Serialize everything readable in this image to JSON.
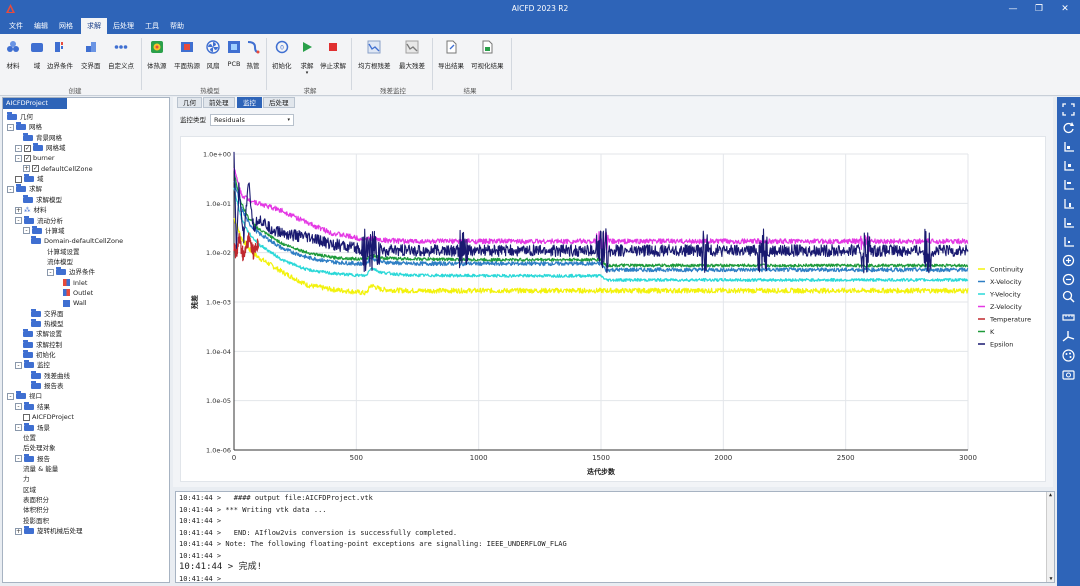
{
  "window": {
    "title": "AICFD 2023 R2"
  },
  "menu": [
    "文件",
    "编辑",
    "网格",
    "求解",
    "后处理",
    "工具",
    "帮助"
  ],
  "menu_active": "求解",
  "ribbon": {
    "groups": [
      {
        "label": "创建",
        "buttons": [
          "材料",
          "域",
          "边界条件",
          "交界面",
          "自定义点"
        ]
      },
      {
        "label": "热模型",
        "buttons": [
          "体热源",
          "平面热源",
          "风扇",
          "PCB",
          "热管"
        ]
      },
      {
        "label": "求解",
        "buttons": [
          "初始化",
          "求解",
          "停止求解"
        ]
      },
      {
        "label": "残差监控",
        "buttons": [
          "均方根残差",
          "最大残差"
        ]
      },
      {
        "label": "结果",
        "buttons": [
          "导出结果",
          "可视化结果"
        ]
      }
    ]
  },
  "tree": {
    "header": "AICFDProject",
    "nodes": [
      "几何",
      "网格",
      "背景网格",
      "网格域",
      "burner",
      "defaultCellZone",
      "域",
      "求解",
      "求解模型",
      "材料",
      "流动分析",
      "计算域",
      "Domain-defaultCellZone",
      "计算域设置",
      "流体模型",
      "边界条件",
      "Inlet",
      "Outlet",
      "Wall",
      "交界面",
      "热模型",
      "求解设置",
      "求解控制",
      "初始化",
      "监控",
      "残差曲线",
      "报告表",
      "视口",
      "结果",
      "AICFDProject",
      "场景",
      "位置",
      "后处理对象",
      "报告",
      "流量 & 能量",
      "力",
      "区域",
      "表面积分",
      "体积积分",
      "投影面积",
      "旋转机械后处理"
    ]
  },
  "tabs": [
    "几何",
    "前处理",
    "监控",
    "后处理"
  ],
  "tab_active": "监控",
  "monitor": {
    "type_label": "监控类型",
    "type_value": "Residuals"
  },
  "chart_data": {
    "type": "line",
    "xlabel": "迭代步数",
    "ylabel": "残差",
    "xlim": [
      0,
      3000
    ],
    "ylim": [
      1e-06,
      1
    ],
    "yscale": "log",
    "xticks": [
      "0",
      "500",
      "1000",
      "1500",
      "2000",
      "2500",
      "3000"
    ],
    "yticks": [
      "1.0e+00",
      "1.0e-01",
      "1.0e-02",
      "1.0e-03",
      "1.0e-04",
      "1.0e-05",
      "1.0e-06"
    ],
    "legend_position": "right",
    "series": [
      {
        "name": "Continuity",
        "color": "#f2f20c",
        "x": [
          0,
          30,
          60,
          100,
          200,
          300,
          400,
          500,
          540,
          560,
          600,
          700,
          1000,
          1500,
          2000,
          2500,
          3000
        ],
        "y": [
          0.05,
          0.02,
          0.012,
          0.008,
          0.004,
          0.0022,
          0.0018,
          0.0016,
          0.0015,
          0.0022,
          0.0018,
          0.0017,
          0.0017,
          0.0017,
          0.0017,
          0.0017,
          0.0017
        ]
      },
      {
        "name": "X-Velocity",
        "color": "#2e7ec4",
        "x": [
          0,
          30,
          60,
          100,
          200,
          300,
          400,
          500,
          540,
          560,
          600,
          700,
          1000,
          1500,
          1520,
          1600,
          2000,
          2500,
          3000
        ],
        "y": [
          0.3,
          0.08,
          0.04,
          0.025,
          0.012,
          0.008,
          0.0065,
          0.006,
          0.006,
          0.008,
          0.0065,
          0.006,
          0.006,
          0.006,
          0.0045,
          0.0045,
          0.0045,
          0.0045,
          0.0045
        ]
      },
      {
        "name": "Y-Velocity",
        "color": "#2ad8d8",
        "x": [
          0,
          30,
          60,
          100,
          200,
          300,
          400,
          500,
          540,
          560,
          600,
          700,
          1000,
          1500,
          1520,
          1600,
          2000,
          2500,
          3000
        ],
        "y": [
          0.2,
          0.05,
          0.025,
          0.015,
          0.007,
          0.0045,
          0.0038,
          0.0035,
          0.0034,
          0.005,
          0.004,
          0.0035,
          0.0034,
          0.0034,
          0.0028,
          0.0028,
          0.0028,
          0.0028,
          0.0028
        ]
      },
      {
        "name": "Z-Velocity",
        "color": "#e438e4",
        "x": [
          0,
          30,
          60,
          100,
          200,
          300,
          400,
          500,
          540,
          560,
          600,
          700,
          1000,
          1500,
          2000,
          2500,
          3000
        ],
        "y": [
          0.5,
          0.15,
          0.12,
          0.1,
          0.07,
          0.04,
          0.025,
          0.02,
          0.018,
          0.02,
          0.018,
          0.017,
          0.017,
          0.017,
          0.017,
          0.017,
          0.017
        ]
      },
      {
        "name": "Temperature",
        "color": "#c0282e",
        "x": [
          0,
          10,
          20,
          40,
          60,
          80,
          100
        ],
        "y": [
          0.012,
          0.01,
          0.02,
          0.008,
          0.02,
          0.01,
          0.015
        ]
      },
      {
        "name": "K",
        "color": "#1e9a3a",
        "x": [
          0,
          30,
          60,
          100,
          200,
          300,
          400,
          500,
          540,
          560,
          600,
          700,
          1000,
          1500,
          1520,
          1600,
          2000,
          2500,
          3000
        ],
        "y": [
          0.4,
          0.1,
          0.05,
          0.03,
          0.015,
          0.01,
          0.008,
          0.0075,
          0.0072,
          0.009,
          0.0078,
          0.0075,
          0.0072,
          0.0072,
          0.0055,
          0.0055,
          0.0055,
          0.0055,
          0.0055
        ]
      },
      {
        "name": "Epsilon",
        "color": "#191970",
        "x": [
          0,
          10,
          20,
          40,
          60,
          80,
          100,
          150,
          200,
          300,
          400,
          500,
          540,
          560,
          600,
          700,
          1000,
          1500,
          2000,
          2500,
          3000
        ],
        "y": [
          0.9,
          0.01,
          0.2,
          0.02,
          0.25,
          0.03,
          0.05,
          0.03,
          0.025,
          0.02,
          0.015,
          0.012,
          0.011,
          0.012,
          0.011,
          0.011,
          0.011,
          0.011,
          0.011,
          0.011,
          0.011
        ]
      }
    ]
  },
  "console": {
    "lines": [
      "10:41:44 >   #### output file:AICFDProject.vtk",
      "10:41:44 > *** Writing vtk data ...",
      "10:41:44 >",
      "10:41:44 >   END: AIflow2vis conversion is successfully completed.",
      "10:41:44 > Note: The following floating-point exceptions are signalling: IEEE_UNDERFLOW_FLAG",
      "10:41:44 >",
      "10:41:44 > 完成!",
      "10:41:44 >"
    ]
  }
}
